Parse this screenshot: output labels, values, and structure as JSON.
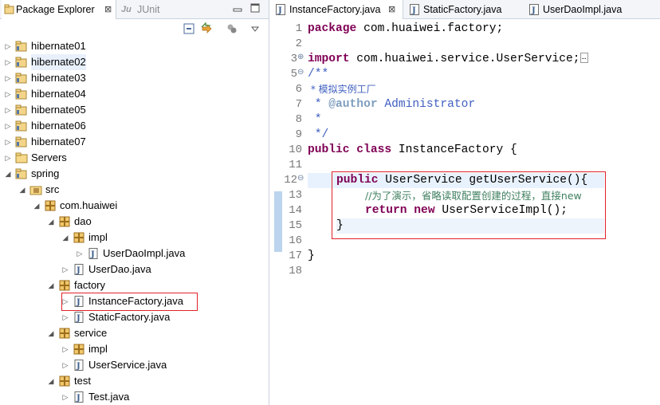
{
  "left_panel": {
    "tabs": {
      "package_explorer": "Package Explorer",
      "close_glyph": "⊠",
      "junit_icon_text": "Ju",
      "junit": "JUnit"
    },
    "tree": [
      {
        "label": "hibernate01",
        "icon": "java-project-icon",
        "state": "collapsed"
      },
      {
        "label": "hibernate02",
        "icon": "java-project-icon",
        "state": "collapsed",
        "selected": true
      },
      {
        "label": "hibernate03",
        "icon": "java-project-icon",
        "state": "collapsed"
      },
      {
        "label": "hibernate04",
        "icon": "java-project-icon",
        "state": "collapsed"
      },
      {
        "label": "hibernate05",
        "icon": "java-project-icon",
        "state": "collapsed"
      },
      {
        "label": "hibernate06",
        "icon": "java-project-icon",
        "state": "collapsed"
      },
      {
        "label": "hibernate07",
        "icon": "java-project-icon",
        "state": "collapsed"
      },
      {
        "label": "Servers",
        "icon": "folder-icon",
        "state": "collapsed"
      },
      {
        "label": "spring",
        "icon": "java-project-icon",
        "state": "expanded"
      },
      {
        "label": "src",
        "icon": "source-folder-icon",
        "state": "expanded"
      },
      {
        "label": "com.huaiwei",
        "icon": "package-icon",
        "state": "expanded"
      },
      {
        "label": "dao",
        "icon": "package-icon",
        "state": "expanded"
      },
      {
        "label": "impl",
        "icon": "package-icon",
        "state": "expanded"
      },
      {
        "label": "UserDaoImpl.java",
        "icon": "java-file-icon",
        "state": "collapsed"
      },
      {
        "label": "UserDao.java",
        "icon": "java-file-icon",
        "state": "collapsed"
      },
      {
        "label": "factory",
        "icon": "package-icon",
        "state": "expanded"
      },
      {
        "label": "InstanceFactory.java",
        "icon": "java-file-icon",
        "state": "collapsed"
      },
      {
        "label": "StaticFactory.java",
        "icon": "java-file-icon",
        "state": "collapsed"
      },
      {
        "label": "service",
        "icon": "package-icon",
        "state": "expanded"
      },
      {
        "label": "impl",
        "icon": "package-icon",
        "state": "collapsed"
      },
      {
        "label": "UserService.java",
        "icon": "java-file-icon",
        "state": "collapsed"
      },
      {
        "label": "test",
        "icon": "package-icon",
        "state": "expanded"
      },
      {
        "label": "Test.java",
        "icon": "java-file-icon",
        "state": "collapsed"
      }
    ]
  },
  "editor": {
    "tabs": [
      {
        "label": "InstanceFactory.java",
        "active": true,
        "close": "⊠"
      },
      {
        "label": "StaticFactory.java",
        "active": false
      },
      {
        "label": "UserDaoImpl.java",
        "active": false
      }
    ],
    "line_numbers": [
      "1",
      "2",
      "3",
      "5",
      "6",
      "7",
      "8",
      "9",
      "10",
      "11",
      "12",
      "13",
      "14",
      "15",
      "16",
      "17",
      "18"
    ],
    "code": {
      "l1_kw": "package",
      "l1_rest": " com.huaiwei.factory;",
      "l3_kw": "import",
      "l3_rest": " com.huaiwei.service.UserService;",
      "l3_fold": "…",
      "l5": "/**",
      "l6": " * 模拟实例工厂",
      "l7_a": " * ",
      "l7_tag": "@author",
      "l7_b": " Administrator",
      "l8": " *",
      "l9": " */",
      "l10_kw": "public class",
      "l10_rest": " InstanceFactory {",
      "l12_kw": "public",
      "l12_rest": " UserService getUserService(){",
      "l13": "//为了演示，省略读取配置创建的过程，直接new",
      "l14_kw": "return new",
      "l14_rest": " UserServiceImpl();",
      "l15": "}",
      "l17": "}"
    }
  }
}
